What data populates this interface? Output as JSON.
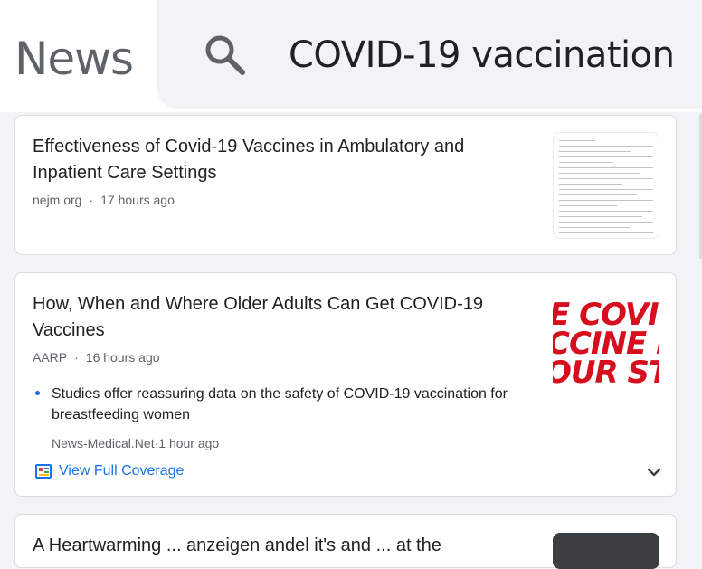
{
  "app": {
    "title": "News"
  },
  "search": {
    "value": "COVID-19 vaccination",
    "icon": "search-icon"
  },
  "articles": [
    {
      "title": "Effectiveness of Covid-19 Vaccines in Ambulatory and Inpatient Care Settings",
      "source": "nejm.org",
      "time": "17 hours ago"
    },
    {
      "title": "How, When and Where Older Adults Can Get COVID-19 Vaccines",
      "source": "AARP",
      "time": "16 hours ago",
      "thumbnail_text": [
        "E COVID",
        "CCINE IN",
        "OUR STAT"
      ],
      "related": {
        "title": "Studies offer reassuring data on the safety of COVID-19 vaccination for breastfeeding women",
        "source": "News-Medical.Net",
        "time": "1 hour ago"
      },
      "coverage_label": "View Full Coverage"
    },
    {
      "title": "A Heartwarming ... anzeigen andel it's and ... at the"
    }
  ],
  "colors": {
    "accent": "#1a73e8",
    "thumbnail_red": "#d50f1e"
  }
}
